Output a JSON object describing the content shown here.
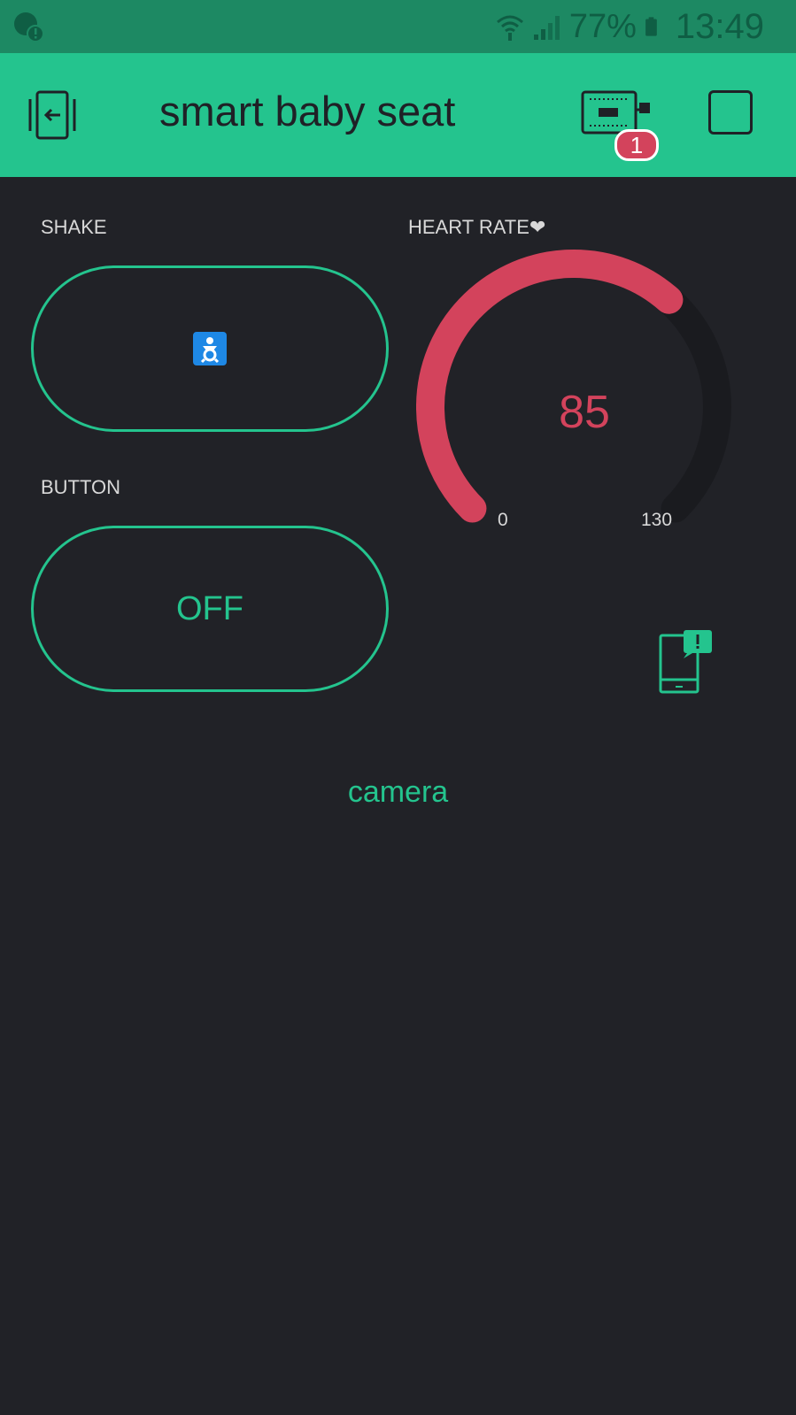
{
  "status_bar": {
    "battery_percent": "77%",
    "time": "13:49",
    "icons": [
      "sync-alert-icon",
      "wifi-icon",
      "signal-icon",
      "battery-icon"
    ]
  },
  "header": {
    "title": "smart baby seat",
    "device_badge_count": "1",
    "icons": [
      "back-icon",
      "device-icon",
      "stop-icon"
    ]
  },
  "widgets": {
    "shake": {
      "label": "SHAKE",
      "icon": "baby-symbol-icon"
    },
    "button": {
      "label": "BUTTON",
      "state": "OFF"
    },
    "heart_rate": {
      "label": "HEART RATE❤",
      "value": "85",
      "min": "0",
      "max": "130",
      "value_num": 85,
      "min_num": 0,
      "max_num": 130
    },
    "notification": {
      "icon": "phone-notification-icon"
    },
    "camera": {
      "label": "camera"
    }
  },
  "colors": {
    "accent": "#24c48e",
    "status_bar": "#1d8963",
    "background": "#212227",
    "gauge_fill": "#d3435c",
    "gauge_track": "#1a1b1f"
  }
}
